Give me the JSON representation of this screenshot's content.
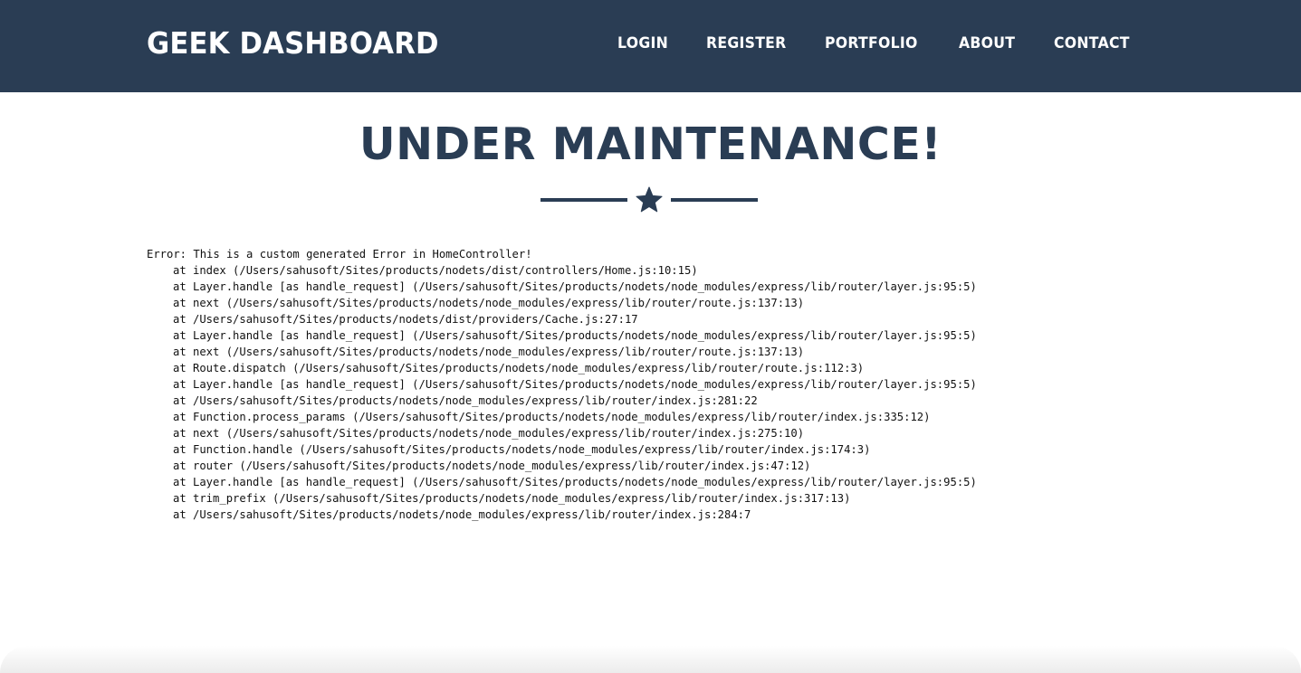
{
  "header": {
    "brand": "GEEK DASHBOARD",
    "background_color": "#2a3d54",
    "nav": [
      {
        "label": "LOGIN"
      },
      {
        "label": "REGISTER"
      },
      {
        "label": "PORTFOLIO"
      },
      {
        "label": "ABOUT"
      },
      {
        "label": "CONTACT"
      }
    ]
  },
  "main": {
    "title": "UNDER MAINTENANCE!",
    "divider_icon": "star-icon",
    "accent_color": "#2a3d54",
    "error": {
      "message": "Error: This is a custom generated Error in HomeController!",
      "frames": [
        "at index (/Users/sahusoft/Sites/products/nodets/dist/controllers/Home.js:10:15)",
        "at Layer.handle [as handle_request] (/Users/sahusoft/Sites/products/nodets/node_modules/express/lib/router/layer.js:95:5)",
        "at next (/Users/sahusoft/Sites/products/nodets/node_modules/express/lib/router/route.js:137:13)",
        "at /Users/sahusoft/Sites/products/nodets/dist/providers/Cache.js:27:17",
        "at Layer.handle [as handle_request] (/Users/sahusoft/Sites/products/nodets/node_modules/express/lib/router/layer.js:95:5)",
        "at next (/Users/sahusoft/Sites/products/nodets/node_modules/express/lib/router/route.js:137:13)",
        "at Route.dispatch (/Users/sahusoft/Sites/products/nodets/node_modules/express/lib/router/route.js:112:3)",
        "at Layer.handle [as handle_request] (/Users/sahusoft/Sites/products/nodets/node_modules/express/lib/router/layer.js:95:5)",
        "at /Users/sahusoft/Sites/products/nodets/node_modules/express/lib/router/index.js:281:22",
        "at Function.process_params (/Users/sahusoft/Sites/products/nodets/node_modules/express/lib/router/index.js:335:12)",
        "at next (/Users/sahusoft/Sites/products/nodets/node_modules/express/lib/router/index.js:275:10)",
        "at Function.handle (/Users/sahusoft/Sites/products/nodets/node_modules/express/lib/router/index.js:174:3)",
        "at router (/Users/sahusoft/Sites/products/nodets/node_modules/express/lib/router/index.js:47:12)",
        "at Layer.handle [as handle_request] (/Users/sahusoft/Sites/products/nodets/node_modules/express/lib/router/layer.js:95:5)",
        "at trim_prefix (/Users/sahusoft/Sites/products/nodets/node_modules/express/lib/router/index.js:317:13)",
        "at /Users/sahusoft/Sites/products/nodets/node_modules/express/lib/router/index.js:284:7"
      ]
    }
  }
}
